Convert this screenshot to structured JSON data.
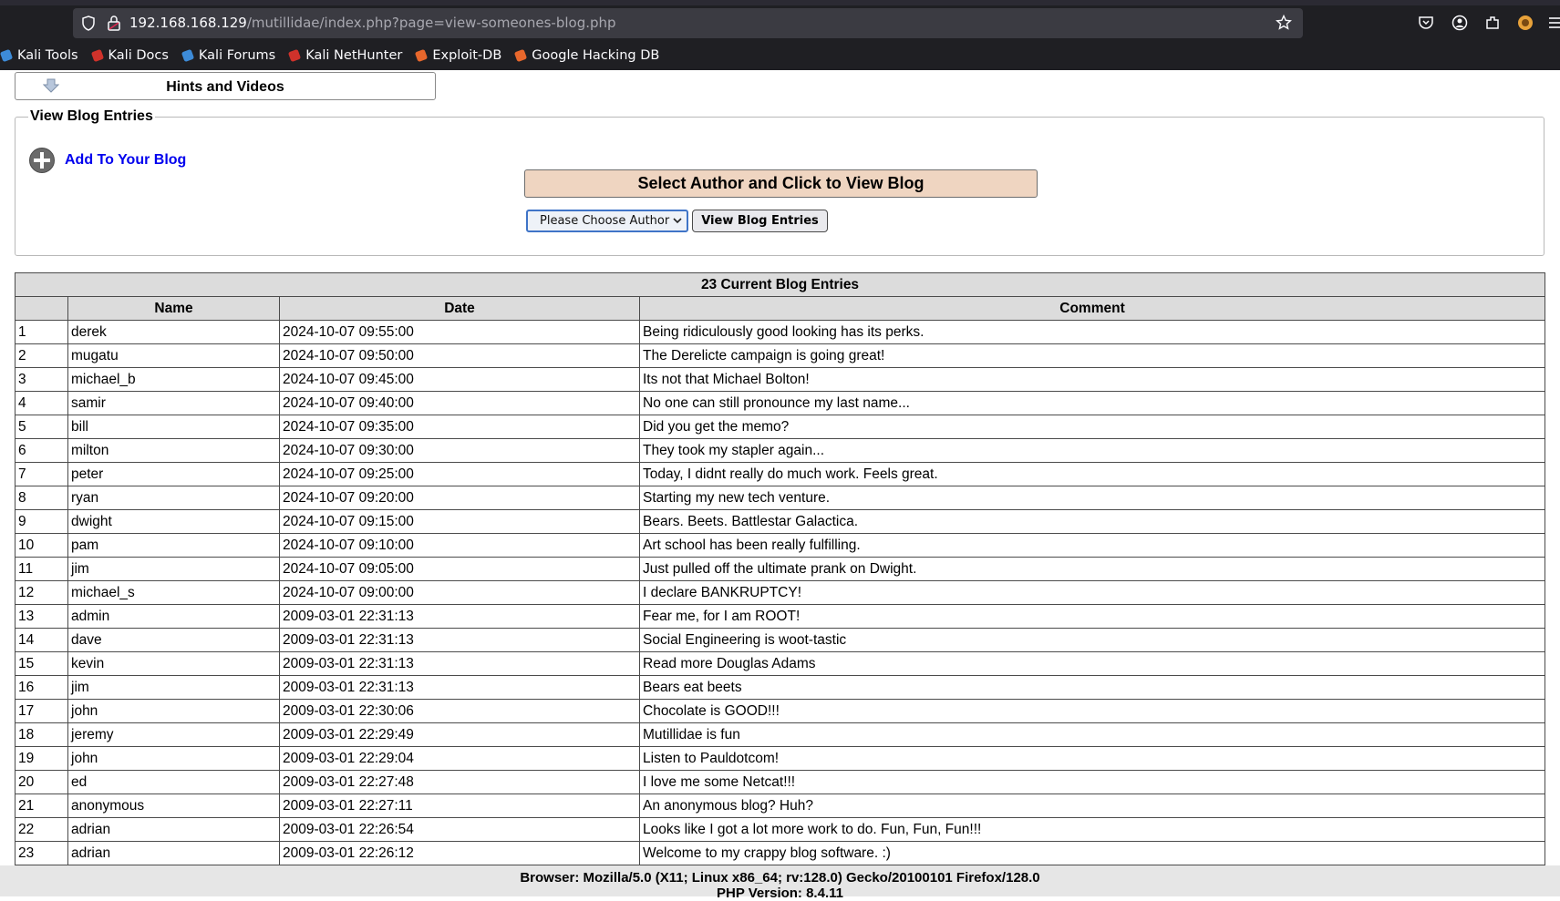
{
  "browser": {
    "url_host": "192.168.168.129",
    "url_path": "/mutillidae/index.php?page=view-someones-blog.php",
    "bookmarks": [
      {
        "label": "Kali Tools",
        "icon": "kali-tools-icon",
        "color": "#3d8bd8"
      },
      {
        "label": "Kali Docs",
        "icon": "kali-docs-icon",
        "color": "#d0322b"
      },
      {
        "label": "Kali Forums",
        "icon": "kali-forums-icon",
        "color": "#3d8bd8"
      },
      {
        "label": "Kali NetHunter",
        "icon": "kali-nethunter-icon",
        "color": "#d0322b"
      },
      {
        "label": "Exploit-DB",
        "icon": "exploit-db-icon",
        "color": "#e8672c"
      },
      {
        "label": "Google Hacking DB",
        "icon": "google-hacking-db-icon",
        "color": "#e8672c"
      }
    ]
  },
  "hints": {
    "label": "Hints and Videos"
  },
  "blog_panel": {
    "legend": "View Blog Entries",
    "add_link": "Add To Your Blog",
    "select_title": "Select Author and Click to View Blog",
    "author_select_value": "Please Choose Author",
    "view_button": "View Blog Entries"
  },
  "table": {
    "caption": "23 Current Blog Entries",
    "headers": [
      "",
      "Name",
      "Date",
      "Comment"
    ],
    "rows": [
      [
        "1",
        "derek",
        "2024-10-07 09:55:00",
        "Being ridiculously good looking has its perks."
      ],
      [
        "2",
        "mugatu",
        "2024-10-07 09:50:00",
        "The Derelicte campaign is going great!"
      ],
      [
        "3",
        "michael_b",
        "2024-10-07 09:45:00",
        "Its not that Michael Bolton!"
      ],
      [
        "4",
        "samir",
        "2024-10-07 09:40:00",
        "No one can still pronounce my last name..."
      ],
      [
        "5",
        "bill",
        "2024-10-07 09:35:00",
        "Did you get the memo?"
      ],
      [
        "6",
        "milton",
        "2024-10-07 09:30:00",
        "They took my stapler again..."
      ],
      [
        "7",
        "peter",
        "2024-10-07 09:25:00",
        "Today, I didnt really do much work. Feels great."
      ],
      [
        "8",
        "ryan",
        "2024-10-07 09:20:00",
        "Starting my new tech venture."
      ],
      [
        "9",
        "dwight",
        "2024-10-07 09:15:00",
        "Bears. Beets. Battlestar Galactica."
      ],
      [
        "10",
        "pam",
        "2024-10-07 09:10:00",
        "Art school has been really fulfilling."
      ],
      [
        "11",
        "jim",
        "2024-10-07 09:05:00",
        "Just pulled off the ultimate prank on Dwight."
      ],
      [
        "12",
        "michael_s",
        "2024-10-07 09:00:00",
        "I declare BANKRUPTCY!"
      ],
      [
        "13",
        "admin",
        "2009-03-01 22:31:13",
        "Fear me, for I am ROOT!"
      ],
      [
        "14",
        "dave",
        "2009-03-01 22:31:13",
        "Social Engineering is woot-tastic"
      ],
      [
        "15",
        "kevin",
        "2009-03-01 22:31:13",
        "Read more Douglas Adams"
      ],
      [
        "16",
        "jim",
        "2009-03-01 22:31:13",
        "Bears eat beets"
      ],
      [
        "17",
        "john",
        "2009-03-01 22:30:06",
        "Chocolate is GOOD!!!"
      ],
      [
        "18",
        "jeremy",
        "2009-03-01 22:29:49",
        "Mutillidae is fun"
      ],
      [
        "19",
        "john",
        "2009-03-01 22:29:04",
        "Listen to Pauldotcom!"
      ],
      [
        "20",
        "ed",
        "2009-03-01 22:27:48",
        "I love me some Netcat!!!"
      ],
      [
        "21",
        "anonymous",
        "2009-03-01 22:27:11",
        "An anonymous blog? Huh?"
      ],
      [
        "22",
        "adrian",
        "2009-03-01 22:26:54",
        "Looks like I got a lot more work to do. Fun, Fun, Fun!!!"
      ],
      [
        "23",
        "adrian",
        "2009-03-01 22:26:12",
        "Welcome to my crappy blog software. :)"
      ]
    ]
  },
  "footer": {
    "browser_line": "Browser: Mozilla/5.0 (X11; Linux x86_64; rv:128.0) Gecko/20100101 Firefox/128.0",
    "php_line": "PHP Version: 8.4.11"
  }
}
